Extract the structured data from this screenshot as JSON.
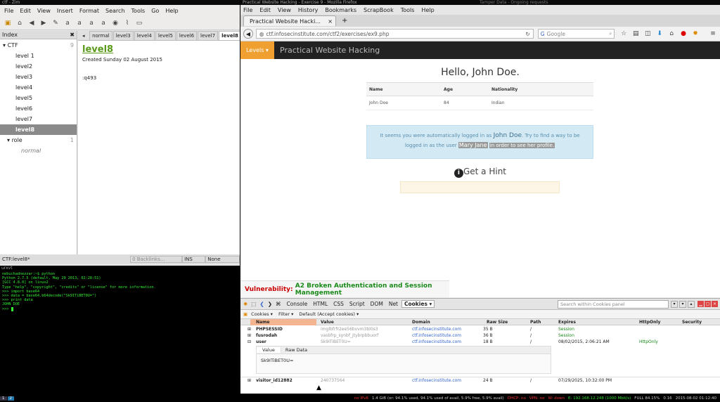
{
  "zim": {
    "window_title": "ctf - Zim",
    "menu": [
      "File",
      "Edit",
      "View",
      "Insert",
      "Format",
      "Search",
      "Tools",
      "Go",
      "Help"
    ],
    "index_label": "Index",
    "tree": [
      {
        "label": "CTF",
        "count": "9",
        "expanded": "▾"
      },
      {
        "label": "level 1"
      },
      {
        "label": "level2"
      },
      {
        "label": "level3"
      },
      {
        "label": "level4"
      },
      {
        "label": "level5"
      },
      {
        "label": "level6"
      },
      {
        "label": "level7"
      },
      {
        "label": "level8"
      },
      {
        "label": "role",
        "count": "1",
        "expanded": "▾"
      },
      {
        "label": "normal"
      }
    ],
    "tabs": [
      "normal",
      "level3",
      "level4",
      "level5",
      "level6",
      "level7",
      "level8"
    ],
    "page_title": "level8",
    "created": "Created Sunday 02 August 2015",
    "body": ":q493",
    "status": {
      "path": "CTF:level8*",
      "backlinks": "0 Backlinks...",
      "mode": "INS",
      "style": "None"
    }
  },
  "terminal": {
    "title": "urxvt",
    "lines": [
      "nebuchadnezzar:~$ python",
      "Python 2.7.5 (default, May 29 2013, 02:28:51)",
      "[GCC 4.8.0] on linux2",
      "Type \"help\", \"copyright\", \"credits\" or \"license\" for more information.",
      ">>> import base64",
      ">>> data = base64.b64decode(\"Sk9ITiBET0U=\")",
      ">>> print data",
      "JOHN DOE",
      ">>> "
    ]
  },
  "firefox": {
    "window_title": "Practical Website Hacking - Exercise 9 - Mozilla Firefox",
    "tamper_title": "Tamper Data - Ongoing requests",
    "menu": [
      "File",
      "Edit",
      "View",
      "History",
      "Bookmarks",
      "ScrapBook",
      "Tools",
      "Help"
    ],
    "tab_label": "Practical Website Hacki...",
    "url": "ctf.infosecinstitute.com/ctf2/exercises/ex9.php",
    "search_placeholder": "Google"
  },
  "site": {
    "levels_btn": "Levels ▾",
    "brand": "Practical Website Hacking",
    "hello": "Hello, John Doe.",
    "table": {
      "headers": [
        "Name",
        "Age",
        "Nationality"
      ],
      "row": [
        "John Doe",
        "84",
        "Indian"
      ]
    },
    "info_pre": "It seems you were automatically logged in as",
    "info_name": "John Doe",
    "info_mid": ". Try to find a way to be logged in as the user",
    "info_user": "Mary Jane",
    "info_post": "in order to see her profile.",
    "hint": "Get a Hint",
    "vuln_label": "Vulnerability:",
    "vuln_text": "A2 Broken Authentication and Session Management"
  },
  "firebug": {
    "tabs": [
      "Console",
      "HTML",
      "CSS",
      "Script",
      "DOM",
      "Net",
      "Cookies ▾"
    ],
    "search_placeholder": "Search within Cookies panel",
    "subbar": [
      "Cookies ▾",
      "Filter ▾",
      "Default (Accept cookies) ▾"
    ],
    "headers": [
      "Name",
      "Value",
      "Domain",
      "Raw Size",
      "Path",
      "Expires",
      "HttpOnly",
      "Security"
    ],
    "rows": [
      {
        "name": "PHPSESSID",
        "value": "imglbfrfr2ee56bvvm3bl0s3",
        "domain": "ctf.infosecinstitute.com",
        "size": "35 B",
        "path": "/",
        "expires": "Session",
        "http": ""
      },
      {
        "name": "fusrodah",
        "value": "vasbfrp_synbf_jtybrpbbuorf",
        "domain": "ctf.infosecinstitute.com",
        "size": "36 B",
        "path": "/",
        "expires": "Session",
        "http": ""
      },
      {
        "name": "user",
        "value": "Sk9ITiBET0U=",
        "domain": "ctf.infosecinstitute.com",
        "size": "18 B",
        "path": "/",
        "expires": "08/02/2015, 2:06:21 AM",
        "http": "HttpOnly"
      }
    ],
    "detail_tabs": [
      "Value",
      "Raw Data"
    ],
    "detail_value": "Sk9ITiBET0U=",
    "last": {
      "name": "visitor_id12882",
      "value": "240737564",
      "domain": "ctf.infosecinstitute.com",
      "size": "24 B",
      "path": "/",
      "expires": "07/29/2025, 10:32:00 PM"
    }
  },
  "statusbar": {
    "workspaces": [
      "1",
      "2"
    ],
    "items": [
      "no IPv6",
      "1.4 GiB (or: 94.1% used, 94.1% used of avail, 5.9% free, 5.9% avail)",
      "DHCP: no",
      "VPN: no",
      "W: down",
      "E: 192.168.12.248 (1000 Mbit/s)",
      "FULL 84.15%",
      "0.16",
      "2015-08-02 01:12:40"
    ]
  }
}
